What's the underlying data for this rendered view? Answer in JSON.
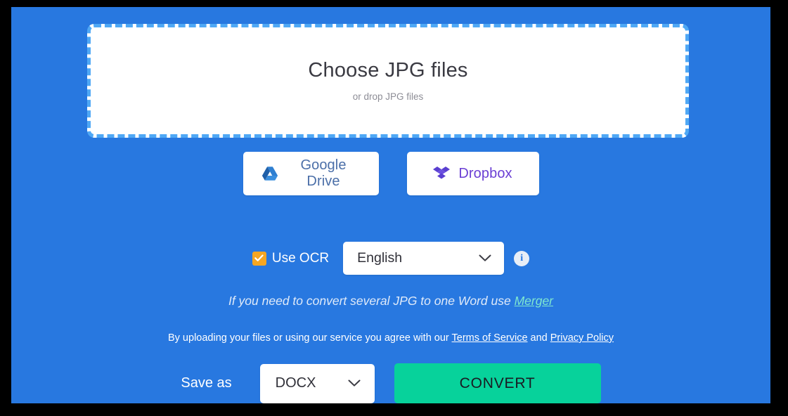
{
  "dropzone": {
    "title": "Choose JPG files",
    "subtitle": "or drop JPG files"
  },
  "cloud": {
    "google_drive": {
      "label": "Google Drive",
      "icon": "google-drive-icon",
      "color": "#4b6fa8"
    },
    "dropbox": {
      "label": "Dropbox",
      "icon": "dropbox-icon",
      "color": "#6b3fd4"
    }
  },
  "ocr": {
    "checkbox_checked": true,
    "checkbox_color": "#f5a623",
    "label": "Use OCR",
    "language_value": "English",
    "language_options": [
      "English"
    ],
    "info_icon": "info-icon",
    "chevron_icon": "chevron-down-icon"
  },
  "merger": {
    "prefix": "If you need to convert several JPG to one Word use ",
    "link_text": "Merger",
    "link_color": "#7fe8cf"
  },
  "terms": {
    "prefix": "By uploading your files or using our service you agree with our ",
    "terms_link": "Terms of Service",
    "conjunction": " and ",
    "privacy_link": "Privacy Policy"
  },
  "bottom": {
    "save_as_label": "Save as",
    "format_value": "DOCX",
    "format_options": [
      "DOCX"
    ],
    "convert_label": "CONVERT",
    "convert_color": "#07d29b",
    "chevron_icon": "chevron-down-icon"
  },
  "theme": {
    "background": "#2878e0",
    "frame": "#000000",
    "dropzone_border": "#4fa8f5",
    "panel": "#ffffff"
  }
}
